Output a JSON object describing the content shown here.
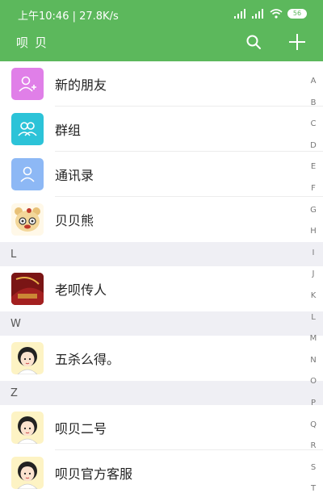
{
  "status_bar": {
    "time_speed": "上午10:46 | 27.8K/s",
    "battery": "56"
  },
  "header": {
    "title": "呗贝",
    "search_icon": "search-icon",
    "add_icon": "plus-icon",
    "color": "#5cb85c"
  },
  "contacts": {
    "special": [
      {
        "label": "新的朋友",
        "icon": "add-friend-icon",
        "color": "#e07fe8"
      },
      {
        "label": "群组",
        "icon": "group-icon",
        "color": "#2cc3d8"
      },
      {
        "label": "通讯录",
        "icon": "contacts-icon",
        "color": "#8db8f5"
      },
      {
        "label": "贝贝熊",
        "icon": "bear-avatar"
      }
    ],
    "sections": [
      {
        "letter": "L",
        "items": [
          {
            "label": "老呗传人"
          }
        ]
      },
      {
        "letter": "W",
        "items": [
          {
            "label": "五杀么得。"
          }
        ]
      },
      {
        "letter": "Z",
        "items": [
          {
            "label": "呗贝二号"
          },
          {
            "label": "呗贝官方客服"
          }
        ]
      }
    ]
  },
  "index_letters": [
    "A",
    "B",
    "C",
    "D",
    "E",
    "F",
    "G",
    "H",
    "I",
    "J",
    "K",
    "L",
    "M",
    "N",
    "O",
    "P",
    "Q",
    "R",
    "S",
    "T"
  ]
}
